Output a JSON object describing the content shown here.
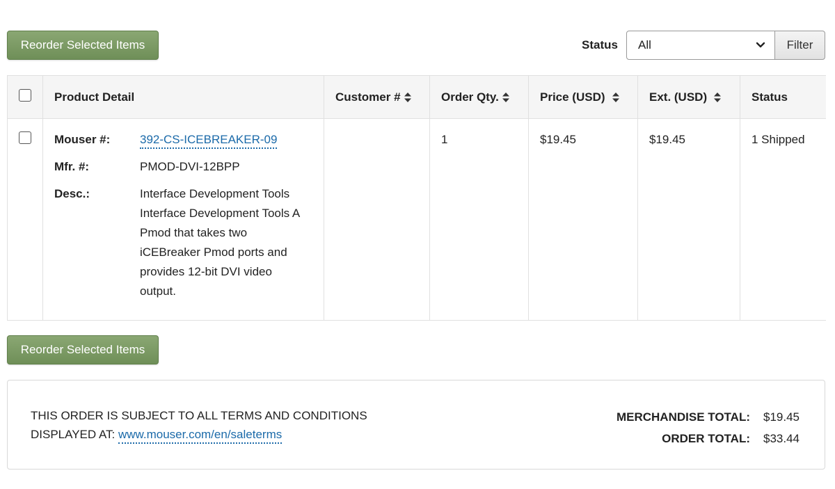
{
  "toolbar": {
    "reorder_label": "Reorder Selected Items",
    "status_label": "Status",
    "status_selected": "All",
    "filter_label": "Filter"
  },
  "table": {
    "columns": [
      "Product Detail",
      "Customer #",
      "Order Qty.",
      "Price (USD)",
      "Ext. (USD)",
      "Status"
    ],
    "rows": [
      {
        "mouser_label": "Mouser #:",
        "mouser_no": "392-CS-ICEBREAKER-09",
        "mfr_label": "Mfr. #:",
        "mfr_no": "PMOD-DVI-12BPP",
        "desc_label": "Desc.:",
        "desc": "Interface Development Tools Interface Development Tools A Pmod that takes two iCEBreaker Pmod ports and provides 12-bit DVI video output.",
        "customer_no": "",
        "qty": "1",
        "price": "$19.45",
        "ext": "$19.45",
        "status": "1 Shipped"
      }
    ]
  },
  "footer": {
    "reorder_label": "Reorder Selected Items",
    "terms_line1": "THIS ORDER IS SUBJECT TO ALL TERMS AND CONDITIONS",
    "terms_line2_prefix": "DISPLAYED AT:",
    "terms_link": "www.mouser.com/en/saleterms",
    "merch_total_label": "MERCHANDISE TOTAL:",
    "merch_total_value": "$19.45",
    "order_total_label": "ORDER TOTAL:",
    "order_total_value": "$33.44"
  },
  "colors": {
    "reorder_button": "#7c9b65",
    "link": "#1b6aa9"
  }
}
